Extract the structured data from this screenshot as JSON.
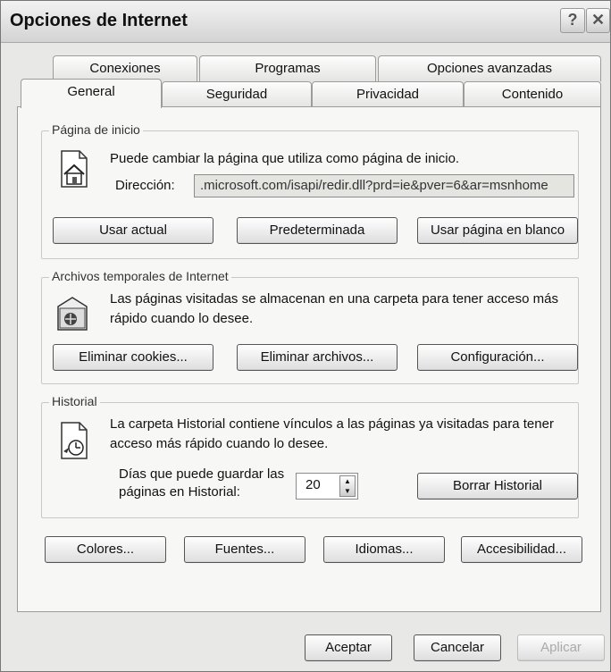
{
  "window": {
    "title": "Opciones de Internet",
    "help": "?",
    "close": "✕"
  },
  "tabs_back": [
    "Conexiones",
    "Programas",
    "Opciones avanzadas"
  ],
  "tabs_front": [
    "General",
    "Seguridad",
    "Privacidad",
    "Contenido"
  ],
  "home": {
    "group_label": "Página de inicio",
    "description": "Puede cambiar la página que utiliza como página de inicio.",
    "address_label": "Dirección:",
    "address_value": ".microsoft.com/isapi/redir.dll?prd=ie&pver=6&ar=msnhome",
    "buttons": [
      "Usar actual",
      "Predeterminada",
      "Usar página en blanco"
    ]
  },
  "temp": {
    "group_label": "Archivos temporales de Internet",
    "description_1": "Las páginas visitadas se almacenan en una carpeta para tener acceso más",
    "description_2": "rápido cuando lo desee.",
    "buttons": [
      "Eliminar cookies...",
      "Eliminar archivos...",
      "Configuración..."
    ]
  },
  "history": {
    "group_label": "Historial",
    "description_1": "La carpeta Historial contiene vínculos a las páginas ya visitadas para tener",
    "description_2": "acceso más rápido cuando lo desee.",
    "days_label_1": "Días que puede guardar las",
    "days_label_2": "páginas en Historial:",
    "days_value": "20",
    "clear_button": "Borrar Historial"
  },
  "bottom_buttons": [
    "Colores...",
    "Fuentes...",
    "Idiomas...",
    "Accesibilidad..."
  ],
  "dialog_buttons": {
    "ok": "Aceptar",
    "cancel": "Cancelar",
    "apply": "Aplicar"
  }
}
